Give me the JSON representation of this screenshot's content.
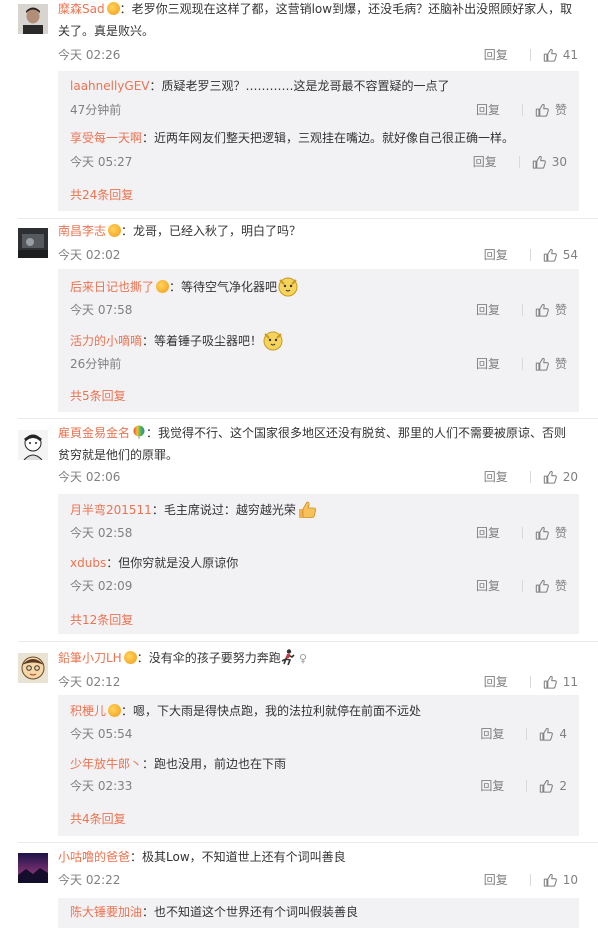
{
  "threads": [
    {
      "author": "糜森Sad",
      "text": "：老罗你三观现在这样了都，这营销low到爆，还没毛病？还脑补出没照顾好家人，取关了。真是败兴。",
      "time": "今天 02:26",
      "reply_label": "回复",
      "likes": "41",
      "subs": [
        {
          "author": "laahnellyGEV",
          "text": "：质疑老罗三观？…………这是龙哥最不容置疑的一点了",
          "time": "47分钟前",
          "reply_label": "回复",
          "likes": "赞"
        },
        {
          "author": "享受每一天啊",
          "text": "：近两年网友们整天把逻辑，三观挂在嘴边。就好像自己很正确一样。",
          "time": "今天 05:27",
          "reply_label": "回复",
          "likes": "30"
        }
      ],
      "more": "共24条回复"
    },
    {
      "author": "南昌李志",
      "text": "：龙哥，已经入秋了，明白了吗？",
      "time": "今天 02:02",
      "reply_label": "回复",
      "likes": "54",
      "subs": [
        {
          "author": "后来日记也撕了",
          "text": "：等待空气净化器吧",
          "time": "今天 07:58",
          "reply_label": "回复",
          "likes": "赞"
        },
        {
          "author": "活力的小嘀嘀",
          "text": "：等着锤子吸尘器吧！",
          "time": "26分钟前",
          "reply_label": "回复",
          "likes": "赞"
        }
      ],
      "more": "共5条回复"
    },
    {
      "author": "雇頁金易金名",
      "text": "：我觉得不行、这个国家很多地区还没有脱贫、那里的人们不需要被原谅、否则贫穷就是他们的原罪。",
      "time": "今天 02:06",
      "reply_label": "回复",
      "likes": "20",
      "subs": [
        {
          "author": "月半弯201511",
          "text": "：毛主席说过：越穷越光荣",
          "time": "今天 02:58",
          "reply_label": "回复",
          "likes": "赞"
        },
        {
          "author": "xdubs",
          "text": "：但你穷就是没人原谅你",
          "time": "今天 02:09",
          "reply_label": "回复",
          "likes": "赞"
        }
      ],
      "more": "共12条回复"
    },
    {
      "author": "鉛筆小刀LH",
      "text": "：没有伞的孩子要努力奔跑",
      "time": "今天 02:12",
      "reply_label": "回复",
      "likes": "11",
      "subs": [
        {
          "author": "积梗儿",
          "text": "：嗯，下大雨是得快点跑，我的法拉利就停在前面不远处",
          "time": "今天 05:54",
          "reply_label": "回复",
          "likes": "4"
        },
        {
          "author": "少年放牛郎丶",
          "text": "：跑也没用，前边也在下雨",
          "time": "今天 02:33",
          "reply_label": "回复",
          "likes": "2"
        }
      ],
      "more": "共4条回复"
    },
    {
      "author": "小咕噜的爸爸",
      "text": "：极其Low，不知道世上还有个词叫善良",
      "time": "今天 02:22",
      "reply_label": "回复",
      "likes": "10",
      "subs": [
        {
          "author": "陈大锤要加油",
          "text": "：也不知道这个世界还有个词叫假装善良"
        }
      ]
    }
  ],
  "colors": {
    "name": "#eb7350",
    "meta": "#808080",
    "sub_bg": "#f2f2f5"
  },
  "icons": [
    "vip-badge-icon",
    "thumb-up-icon",
    "emoji-icon"
  ]
}
